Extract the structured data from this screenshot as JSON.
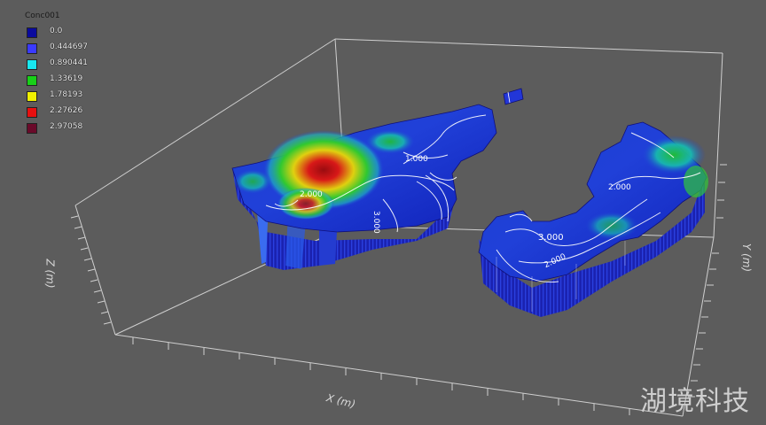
{
  "legend": {
    "title": "Conc001",
    "items": [
      {
        "label": "0.0",
        "color": "#0a0a9e"
      },
      {
        "label": "0.444697",
        "color": "#3a3aff"
      },
      {
        "label": "0.890441",
        "color": "#18e8f0"
      },
      {
        "label": "1.33619",
        "color": "#18d018"
      },
      {
        "label": "1.78193",
        "color": "#f0f000"
      },
      {
        "label": "2.27626",
        "color": "#e81010"
      },
      {
        "label": "2.97058",
        "color": "#6a0a2a"
      }
    ]
  },
  "axes": {
    "x_label": "X (m)",
    "y_label": "Y (m)",
    "z_label": "Z (m)"
  },
  "contours": {
    "left_1": "1.000",
    "left_2": "2.000",
    "left_3": "3.000",
    "right_1": "3.000",
    "right_2": "2.000",
    "right_3": "2.000"
  },
  "watermark": "湖境科技"
}
